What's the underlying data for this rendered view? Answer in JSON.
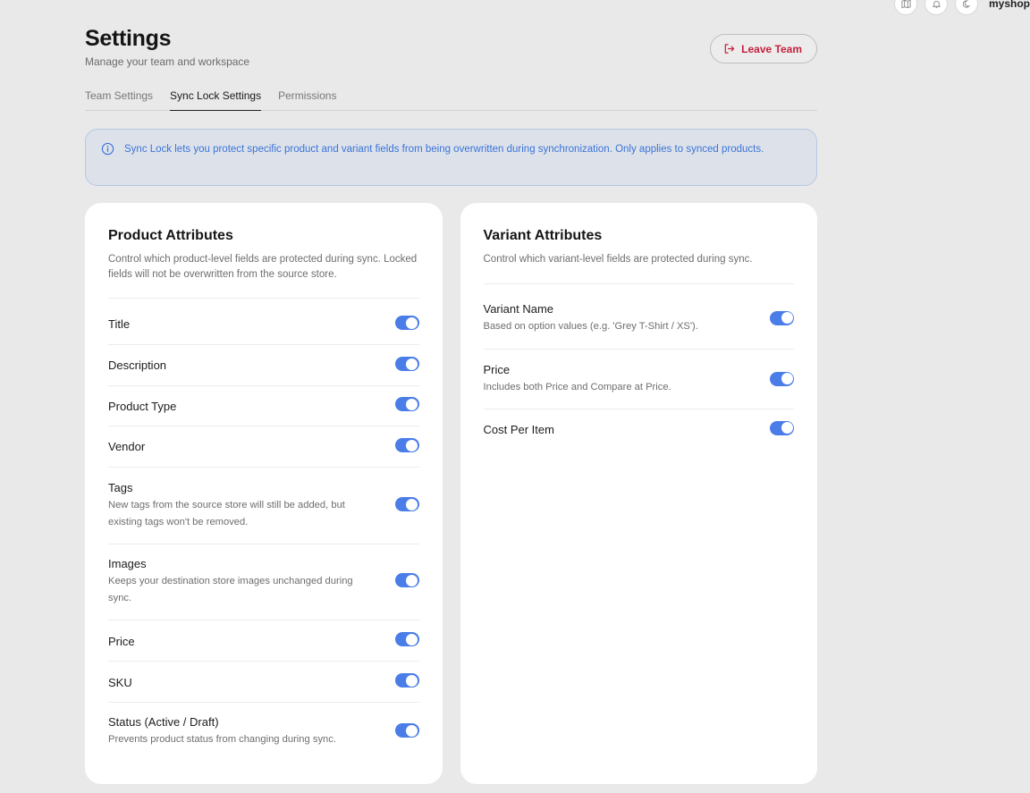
{
  "topbar": {
    "icons": [
      "map-icon",
      "bell-icon",
      "moon-icon"
    ],
    "user": "myshops-"
  },
  "header": {
    "title": "Settings",
    "subtitle": "Manage your team and workspace",
    "leave_label": "Leave Team"
  },
  "tabs": [
    {
      "label": "Team Settings",
      "active": false
    },
    {
      "label": "Sync Lock Settings",
      "active": true
    },
    {
      "label": "Permissions",
      "active": false
    }
  ],
  "banner": {
    "text": "Sync Lock lets you protect specific product and variant fields from being overwritten during synchronization. Only applies to synced products."
  },
  "product": {
    "title": "Product Attributes",
    "description": "Control which product-level fields are protected during sync. Locked fields will not be overwritten from the source store.",
    "rows": [
      {
        "label": "Title",
        "desc": "",
        "on": true
      },
      {
        "label": "Description",
        "desc": "",
        "on": true
      },
      {
        "label": "Product Type",
        "desc": "",
        "on": true
      },
      {
        "label": "Vendor",
        "desc": "",
        "on": true
      },
      {
        "label": "Tags",
        "desc": "New tags from the source store will still be added, but existing tags won't be removed.",
        "on": true
      },
      {
        "label": "Images",
        "desc": "Keeps your destination store images unchanged during sync.",
        "on": true
      },
      {
        "label": "Price",
        "desc": "",
        "on": true
      },
      {
        "label": "SKU",
        "desc": "",
        "on": true
      },
      {
        "label": "Status (Active / Draft)",
        "desc": "Prevents product status from changing during sync.",
        "on": true
      }
    ]
  },
  "variant": {
    "title": "Variant Attributes",
    "description": "Control which variant-level fields are protected during sync.",
    "rows": [
      {
        "label": "Variant Name",
        "desc": "Based on option values (e.g. 'Grey T-Shirt / XS').",
        "on": true
      },
      {
        "label": "Price",
        "desc": "Includes both Price and Compare at Price.",
        "on": true
      },
      {
        "label": "Cost Per Item",
        "desc": "",
        "on": true
      }
    ]
  }
}
